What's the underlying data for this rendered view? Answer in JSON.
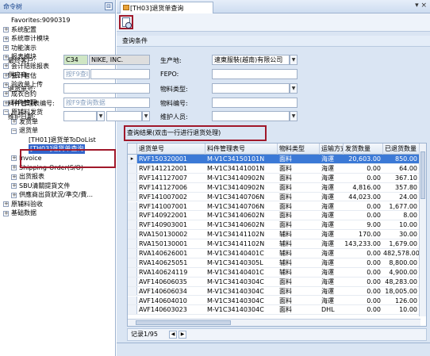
{
  "left_panel": {
    "title": "命令树",
    "pin_glyph": "⊟",
    "tree": [
      {
        "label": "Favorites:9090319",
        "level": 0,
        "expander": "",
        "selected": false
      },
      {
        "label": "系统配置",
        "level": 0,
        "expander": "+",
        "selected": false
      },
      {
        "label": "系统审计模块",
        "level": 0,
        "expander": "+",
        "selected": false
      },
      {
        "label": "功能演示",
        "level": 0,
        "expander": "+",
        "selected": false
      },
      {
        "label": "报表模块",
        "level": 0,
        "expander": "+",
        "selected": false
      },
      {
        "label": "会计结账报表",
        "level": 0,
        "expander": "+",
        "selected": false
      },
      {
        "label": "会计智估",
        "level": 0,
        "expander": "+",
        "selected": false
      },
      {
        "label": "验收单上传",
        "level": 0,
        "expander": "+",
        "selected": false
      },
      {
        "label": "成衣合约",
        "level": 0,
        "expander": "+",
        "selected": false
      },
      {
        "label": "料件管理",
        "level": 0,
        "expander": "+",
        "selected": false
      },
      {
        "label": "原辅料发货",
        "level": 0,
        "expander": "−",
        "selected": false
      },
      {
        "label": "发货单",
        "level": 1,
        "expander": "+",
        "selected": false
      },
      {
        "label": "退货单",
        "level": 1,
        "expander": "−",
        "selected": false
      },
      {
        "label": "[TH01]退货单ToDoList",
        "level": 2,
        "expander": "",
        "selected": false
      },
      {
        "label": "[TH03]退货单查询",
        "level": 2,
        "expander": "",
        "selected": true
      },
      {
        "label": "Invoice",
        "level": 1,
        "expander": "+",
        "selected": false
      },
      {
        "label": "Shipping-Order(S/O)",
        "level": 1,
        "expander": "+",
        "selected": false
      },
      {
        "label": "出货报表",
        "level": 1,
        "expander": "+",
        "selected": false
      },
      {
        "label": "SBU清關提貨文件",
        "level": 1,
        "expander": "+",
        "selected": false
      },
      {
        "label": "供應商出貨狀況/準交/費...",
        "level": 1,
        "expander": "+",
        "selected": false
      },
      {
        "label": "原辅料验收",
        "level": 0,
        "expander": "+",
        "selected": false
      },
      {
        "label": "基础数据",
        "level": 0,
        "expander": "+",
        "selected": false
      }
    ]
  },
  "tab": {
    "label": "[TH03]退货单查询",
    "controls": "▾ ×"
  },
  "conditions": {
    "section_title": "查询条件",
    "customer_label": "最终客户:",
    "customer_code": "C34",
    "customer_name": "NIKE, INC.",
    "producer_label": "生产地:",
    "producer_value": "速東服裝(越南)有限公司",
    "supplier_label": "供应商:",
    "supplier_placeholder": "按F9查I",
    "fepo_label": "FEPO:",
    "return_no_label": "退货单号:",
    "material_type_label": "物料类型:",
    "mgmt_no_label": "料件管理表编号:",
    "mgmt_no_placeholder": "按F9查询数据",
    "material_no_label": "物料编号:",
    "maint_date_label": "维护日期:",
    "maint_person_label": "维护人员:"
  },
  "results": {
    "title": "查询结果(双击一行进行退货处理)",
    "columns": [
      "退货单号",
      "料件管理表号",
      "物料类型",
      "运输方式",
      "发货数量",
      "已退货数量"
    ],
    "rows": [
      [
        "RVF150320001",
        "M-V1C34150101N",
        "面料",
        "海運",
        "20,603.00",
        "850.00"
      ],
      [
        "RVF141212001",
        "M-V1C34141001N",
        "面料",
        "海運",
        "0.00",
        "64.00"
      ],
      [
        "RVF141127007",
        "M-V1C34140902N",
        "面料",
        "海運",
        "0.00",
        "367.10"
      ],
      [
        "RVF141127006",
        "M-V1C34140902N",
        "面料",
        "海運",
        "4,816.00",
        "357.80"
      ],
      [
        "RVF141007002",
        "M-V1C34140706N",
        "面料",
        "海運",
        "44,023.00",
        "24.00"
      ],
      [
        "RVF141007001",
        "M-V1C34140706N",
        "面料",
        "海運",
        "0.00",
        "1,677.00"
      ],
      [
        "RVF140922001",
        "M-V1C34140602N",
        "面料",
        "海運",
        "0.00",
        "8.00"
      ],
      [
        "RVF140903001",
        "M-V1C34140602N",
        "面料",
        "海運",
        "9.00",
        "10.00"
      ],
      [
        "RVA150130002",
        "M-V1C34141102N",
        "辅料",
        "海運",
        "170.00",
        "30.00"
      ],
      [
        "RVA150130001",
        "M-V1C34141102N",
        "辅料",
        "海運",
        "143,233.00",
        "1,679.00"
      ],
      [
        "RVA140626001",
        "M-V1C34140401C",
        "辅料",
        "海運",
        "0.00",
        "482,578.00"
      ],
      [
        "RVA140625051",
        "M-V1C34140305L",
        "辅料",
        "海運",
        "0.00",
        "8,800.00"
      ],
      [
        "RVA140624119",
        "M-V1C34140401C",
        "辅料",
        "海運",
        "0.00",
        "4,900.00"
      ],
      [
        "AVF140606035",
        "M-V1C34140304C",
        "面料",
        "海運",
        "0.00",
        "48,283.00"
      ],
      [
        "AVF140606034",
        "M-V1C34140304C",
        "面料",
        "海運",
        "0.00",
        "18,005.00"
      ],
      [
        "AVF140604010",
        "M-V1C34140304C",
        "面料",
        "海運",
        "0.00",
        "126.00"
      ],
      [
        "AVF140603023",
        "M-V1C34140304C",
        "面料",
        "DHL",
        "0.00",
        "10.00"
      ]
    ],
    "record_text": "记录1/95"
  }
}
